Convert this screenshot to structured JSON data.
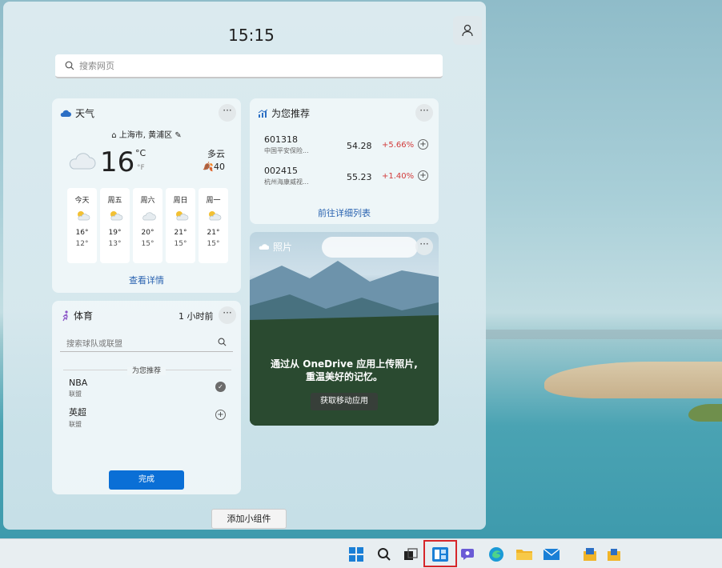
{
  "panel": {
    "time": "15:15",
    "search_placeholder": "搜索网页",
    "add_widget_label": "添加小组件"
  },
  "weather": {
    "title": "天气",
    "location": "上海市, 黄浦区",
    "temperature": "16",
    "unit_c": "°C",
    "unit_f": "°F",
    "condition": "多云",
    "aqi": "40",
    "forecast": [
      {
        "day": "今天",
        "high": "16°",
        "low": "12°"
      },
      {
        "day": "周五",
        "high": "19°",
        "low": "13°"
      },
      {
        "day": "周六",
        "high": "20°",
        "low": "15°"
      },
      {
        "day": "周日",
        "high": "21°",
        "low": "15°"
      },
      {
        "day": "周一",
        "high": "21°",
        "low": "15°"
      }
    ],
    "details_link": "查看详情"
  },
  "stocks": {
    "title": "为您推荐",
    "items": [
      {
        "code": "601318",
        "name": "中国平安保险...",
        "price": "54.28",
        "change": "+5.66%"
      },
      {
        "code": "002415",
        "name": "杭州海康威视...",
        "price": "55.23",
        "change": "+1.40%"
      }
    ],
    "list_link": "前往详细列表"
  },
  "photos": {
    "title": "照片",
    "message_line1": "通过从 OneDrive 应用上传照片,",
    "message_line2": "重温美好的记忆。",
    "button_label": "获取移动应用"
  },
  "sports": {
    "title": "体育",
    "updated": "1 小时前",
    "search_placeholder": "搜索球队或联盟",
    "section_label": "为您推荐",
    "items": [
      {
        "name": "NBA",
        "sub": "联盟",
        "followed": true
      },
      {
        "name": "英超",
        "sub": "联盟",
        "followed": false
      }
    ],
    "done_label": "完成"
  },
  "taskbar": {
    "icons": [
      "start-icon",
      "search-icon",
      "task-view-icon",
      "widgets-icon",
      "chat-icon",
      "edge-icon",
      "file-explorer-icon",
      "mail-icon",
      "app-icon-1",
      "app-icon-2"
    ],
    "highlighted": "widgets-icon",
    "highlight_color": "#d6262a"
  },
  "colors": {
    "accent": "#0a6fd6",
    "link": "#2a63b0",
    "positive_change": "#d23b3b"
  }
}
